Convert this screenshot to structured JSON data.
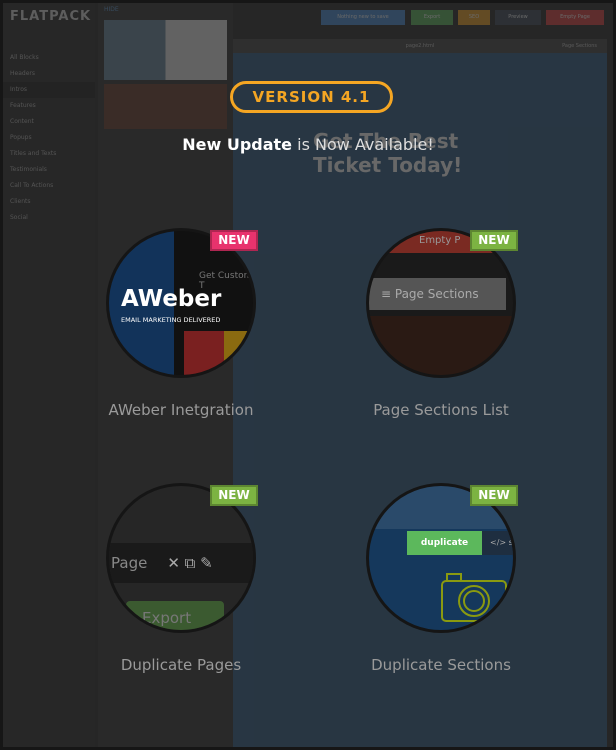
{
  "app": {
    "logo": "FLATPACK",
    "hide": "HIDE",
    "sidebar": [
      "All Blocks",
      "Headers",
      "Intros",
      "Features",
      "Content",
      "Popups",
      "Titles and Texts",
      "Testimonials",
      "Call To Actions",
      "Clients",
      "Social"
    ],
    "toolbar": [
      {
        "label": "Nothing new to save",
        "color": "#4a8fd8"
      },
      {
        "label": "Export",
        "color": "#5cb85c"
      },
      {
        "label": "SEO",
        "color": "#f0a020"
      },
      {
        "label": "Preview",
        "color": "#3d4a5a"
      },
      {
        "label": "Empty Page",
        "color": "#e04040"
      }
    ],
    "page_name": "page2.html",
    "page_sections": "Page Sections",
    "hero": "Get The Best Ticket Today!"
  },
  "overlay": {
    "version": "VERSION 4.1",
    "update_bold": "New Update",
    "update_rest": " is Now Available!",
    "accent": "#f5a623"
  },
  "features": [
    {
      "label": "AWeber Inetgration",
      "badge": "NEW",
      "badge_color": "#e8336d",
      "logo": "AWeber",
      "tagline": "EMAIL MARKETING DELIVERED"
    },
    {
      "label": "Page Sections List",
      "badge": "NEW",
      "badge_color": "#7cb342",
      "inner": "Page Sections",
      "inner2": "Empty P"
    },
    {
      "label": "Duplicate Pages",
      "badge": "NEW",
      "badge_color": "#7cb342",
      "inner": "Page",
      "inner2": "Export"
    },
    {
      "label": "Duplicate Sections",
      "badge": "NEW",
      "badge_color": "#7cb342",
      "inner": "duplicate",
      "inner2": "</> so"
    }
  ]
}
